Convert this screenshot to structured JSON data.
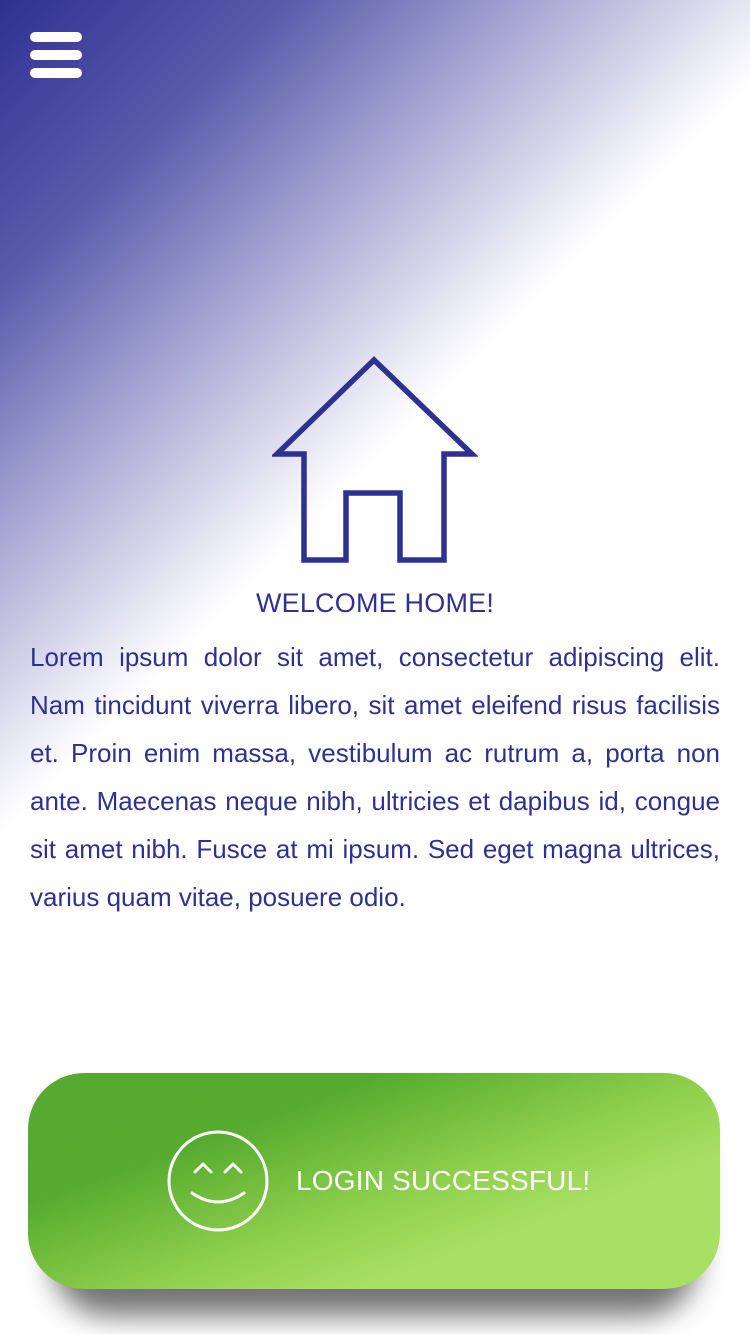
{
  "colors": {
    "primary": "#2f3192",
    "success_start": "#56ab2f",
    "success_end": "#a8e063",
    "text_on_success": "#ffffff"
  },
  "header": {
    "menu_icon": "hamburger-menu-icon"
  },
  "main": {
    "hero_icon": "home-icon",
    "title": "WELCOME HOME!",
    "body": "Lorem ipsum dolor sit amet, consectetur adipiscing elit. Nam tincidunt viverra libero, sit amet eleifend risus facilisis et. Proin enim massa, vestibulum ac rutrum a, porta non ante. Maecenas neque nibh, ultricies et dapibus id, congue sit amet nibh. Fusce at mi ipsum. Sed eget magna ultrices, varius quam vitae, posuere odio."
  },
  "toast": {
    "icon": "smiley-face-icon",
    "message": "LOGIN SUCCESSFUL!"
  }
}
